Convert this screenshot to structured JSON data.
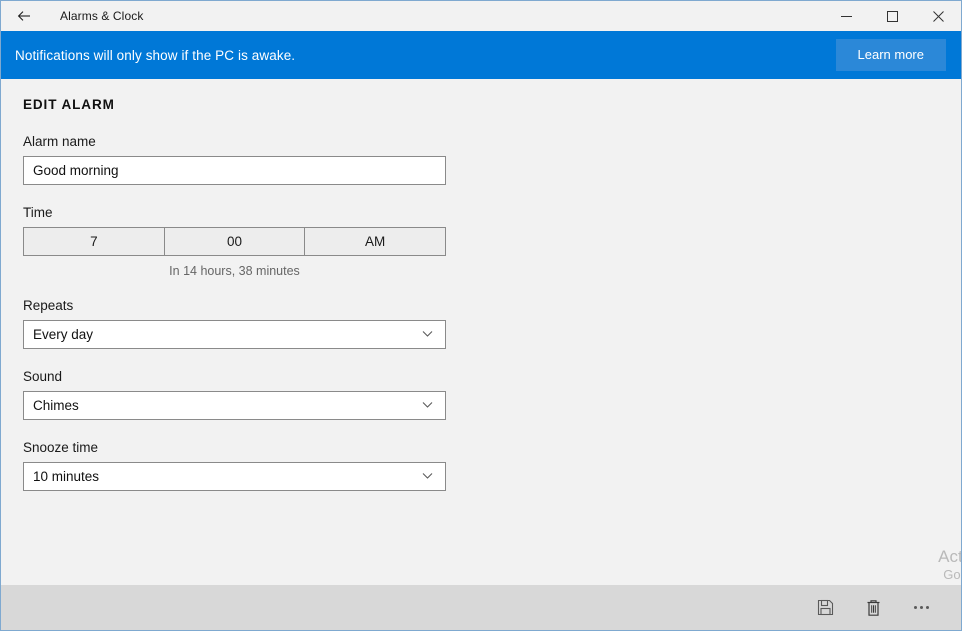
{
  "window": {
    "title": "Alarms & Clock",
    "back_icon": "back-arrow-icon",
    "controls": {
      "minimize": "minimize-icon",
      "maximize": "maximize-icon",
      "close": "close-icon"
    }
  },
  "banner": {
    "message": "Notifications will only show if the PC is awake.",
    "action_label": "Learn more",
    "background_color": "#0078d7",
    "button_color": "#2b88d8"
  },
  "page": {
    "title": "EDIT ALARM"
  },
  "fields": {
    "alarm_name": {
      "label": "Alarm name",
      "value": "Good morning",
      "placeholder": "Alarm name"
    },
    "time": {
      "label": "Time",
      "hour": "7",
      "minute": "00",
      "period": "AM",
      "caption": "In 14 hours, 38 minutes"
    },
    "repeats": {
      "label": "Repeats",
      "value": "Every day"
    },
    "sound": {
      "label": "Sound",
      "value": "Chimes"
    },
    "snooze": {
      "label": "Snooze time",
      "value": "10 minutes"
    }
  },
  "watermark": {
    "line1": "Activ",
    "line2": "Go to"
  },
  "toolbar": {
    "save_icon": "save-icon",
    "delete_icon": "trash-icon",
    "more_icon": "ellipsis-icon"
  }
}
